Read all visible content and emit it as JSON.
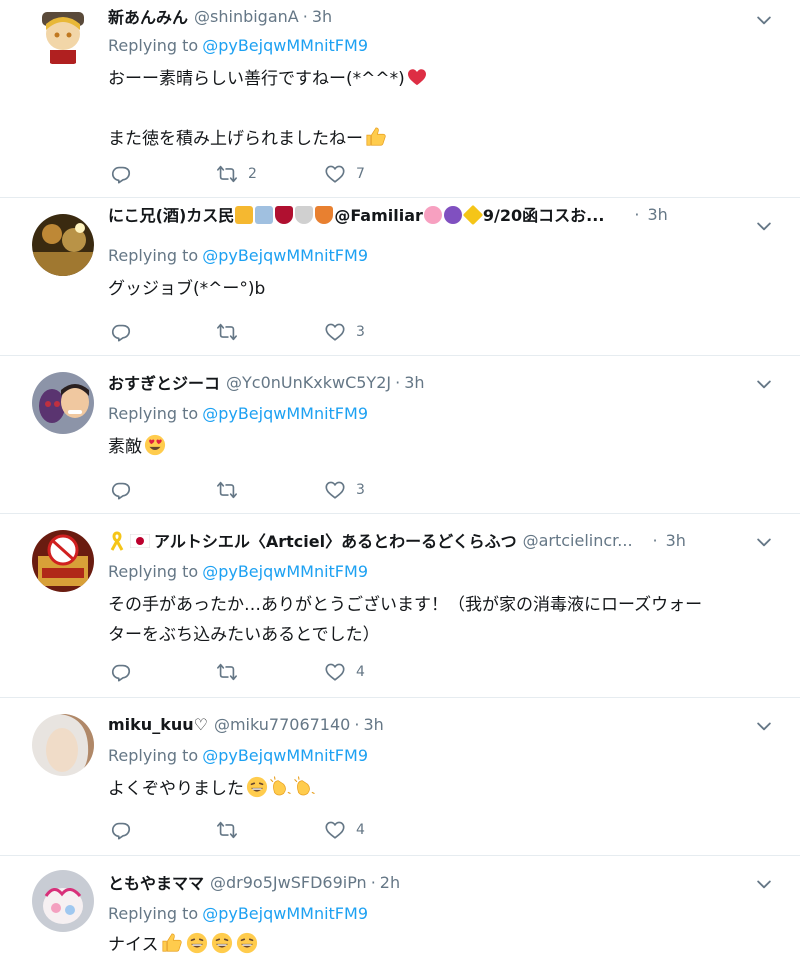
{
  "replying_to_label": "Replying to",
  "tweets": [
    {
      "name": "新あんみん",
      "handle": "@shinbiganA",
      "separator": "·",
      "time": "3h",
      "reply_to": "@pyBejqwMMnitFM9",
      "body_lines": [
        "おーー素晴らしい善行ですねー(*^^*)",
        "",
        "また徳を積み上げられましたねー"
      ],
      "body_emoji": [
        "red-heart",
        "thumbs-up"
      ],
      "retweets": "2",
      "likes": "7"
    },
    {
      "name": "にこ兄(酒)カス民",
      "name_tail": "@Familiar",
      "name_tail2": "9/20函コスお...",
      "handle": "",
      "separator": "·",
      "time": "3h",
      "reply_to": "@pyBejqwMMnitFM9",
      "body_lines": [
        "グッジョブ(*^ー°)b"
      ],
      "retweets": "",
      "likes": "3"
    },
    {
      "name": "おすぎとジーコ",
      "handle": "@Yc0nUnKxkwC5Y2J",
      "separator": "·",
      "time": "3h",
      "reply_to": "@pyBejqwMMnitFM9",
      "body_lines": [
        "素敵"
      ],
      "body_emoji": [
        "heart-eyes"
      ],
      "retweets": "",
      "likes": "3"
    },
    {
      "name": "アルトシエル〈Artciel〉あるとわーるどくらふつ",
      "handle": "@artcielincr...",
      "separator": "·",
      "time": "3h",
      "reply_to": "@pyBejqwMMnitFM9",
      "body_lines": [
        "その手があったか…ありがとうございます！（我が家の消毒液にローズウォー",
        "ターをぶち込みたいあるとでした）"
      ],
      "retweets": "",
      "likes": "4"
    },
    {
      "name": "miku_kuu♡",
      "handle": "@miku77067140",
      "separator": "·",
      "time": "3h",
      "reply_to": "@pyBejqwMMnitFM9",
      "body_lines": [
        "よくぞやりました"
      ],
      "body_emoji": [
        "grin",
        "clap",
        "clap"
      ],
      "retweets": "",
      "likes": "4"
    },
    {
      "name": "ともやまママ",
      "handle": "@dr9o5JwSFD69iPn",
      "separator": "·",
      "time": "2h",
      "reply_to": "@pyBejqwMMnitFM9",
      "body_lines": [
        "ナイス"
      ],
      "body_emoji": [
        "thumbs-up",
        "grin",
        "grin",
        "grin"
      ],
      "retweets": "",
      "likes": ""
    }
  ],
  "colors": {
    "link": "#1da1f2",
    "muted": "#657786",
    "text": "#14171a",
    "divider": "#e6ecf0"
  },
  "icons": {
    "reply": "reply-icon",
    "retweet": "retweet-icon",
    "like": "heart-outline-icon",
    "menu": "chevron-down-icon"
  }
}
